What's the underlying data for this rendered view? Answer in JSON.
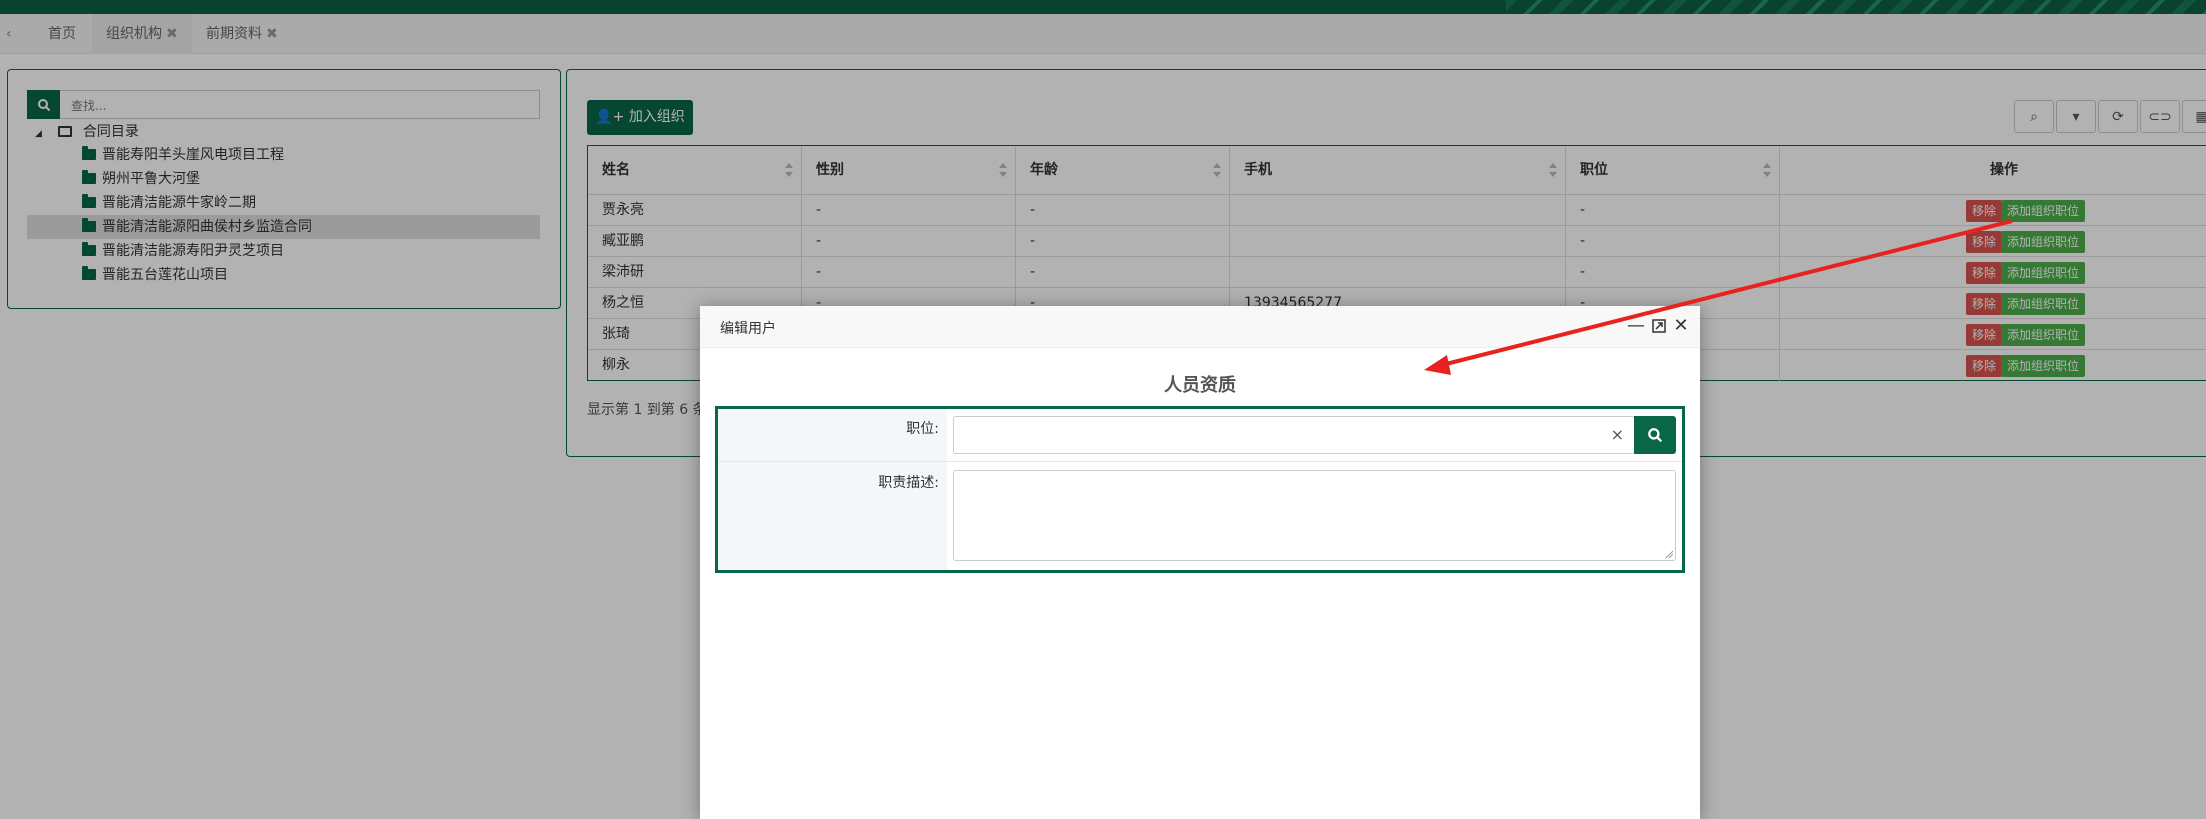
{
  "tabs": {
    "items": [
      {
        "label": "首页",
        "closable": false
      },
      {
        "label": "组织机构",
        "closable": true
      },
      {
        "label": "前期资料",
        "closable": true
      }
    ]
  },
  "tree": {
    "search_placeholder": "查找...",
    "root": "合同目录",
    "items": [
      "晋能寿阳羊头崖风电项目工程",
      "朔州平鲁大河堡",
      "晋能清洁能源牛家岭二期",
      "晋能清洁能源阳曲侯村乡监造合同",
      "晋能清洁能源寿阳尹灵芝项目",
      "晋能五台莲花山项目"
    ],
    "selected_index": 3
  },
  "grid": {
    "add_button": "加入组织",
    "toolbar_icons": [
      "search-icon",
      "export-icon",
      "refresh-icon",
      "toggle-icon",
      "columns-icon"
    ],
    "columns": [
      "姓名",
      "性别",
      "年龄",
      "手机",
      "职位",
      "操作"
    ],
    "rows": [
      {
        "name": "贾永亮",
        "gender": "-",
        "age": "-",
        "phone": "",
        "position": "-"
      },
      {
        "name": "臧亚鹏",
        "gender": "-",
        "age": "-",
        "phone": "",
        "position": "-"
      },
      {
        "name": "梁沛研",
        "gender": "-",
        "age": "-",
        "phone": "",
        "position": "-"
      },
      {
        "name": "杨之恒",
        "gender": "-",
        "age": "-",
        "phone": "13934565277",
        "position": "-"
      },
      {
        "name": "张琦",
        "gender": "-",
        "age": "-",
        "phone": "",
        "position": "-"
      },
      {
        "name": "柳永",
        "gender": "-",
        "age": "-",
        "phone": "",
        "position": "-"
      }
    ],
    "remove_label": "移除",
    "add_position_label": "添加组织职位",
    "footer": "显示第 1 到第 6 条"
  },
  "modal": {
    "title": "编辑用户",
    "section_title": "人员资质",
    "position_label": "职位:",
    "position_value": "",
    "clear_symbol": "×",
    "duty_label": "职责描述:",
    "duty_value": ""
  },
  "colors": {
    "primary": "#0a6648",
    "danger": "#d9534f",
    "success": "#4cae4c",
    "annotation_arrow": "#e8231f"
  }
}
